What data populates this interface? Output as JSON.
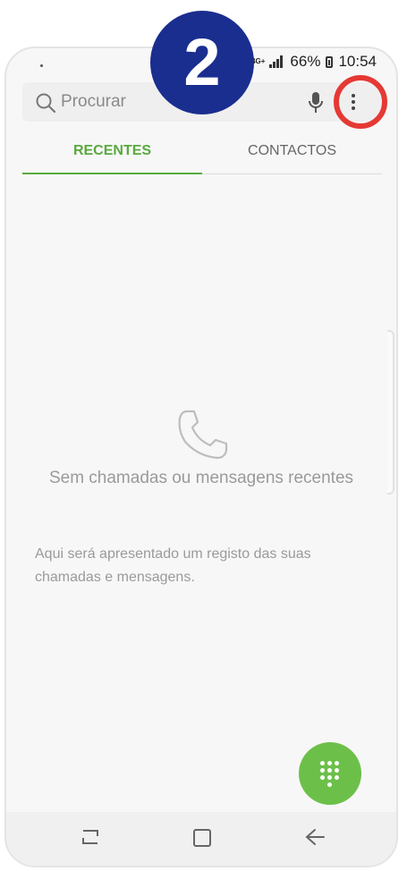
{
  "annotation": {
    "step_number": "2",
    "badge_color": "#1a2e8f",
    "highlight_color": "#e53935"
  },
  "status_bar": {
    "network": "4G+",
    "battery": "66%",
    "time": "10:54"
  },
  "search": {
    "placeholder": "Procurar",
    "icons": [
      "search-icon",
      "mic-icon",
      "more-options-icon"
    ]
  },
  "tabs": [
    {
      "label": "RECENTES",
      "active": true
    },
    {
      "label": "CONTACTOS",
      "active": false
    }
  ],
  "empty_state": {
    "icon": "phone-icon",
    "title": "Sem chamadas ou mensagens recentes",
    "description": "Aqui será apresentado um registo das suas chamadas e mensagens."
  },
  "fab": {
    "icon": "dialpad-icon",
    "color": "#6cc04a"
  },
  "nav_bar": [
    "recent-apps-icon",
    "home-icon",
    "back-icon"
  ],
  "accent_color": "#5aa93f"
}
